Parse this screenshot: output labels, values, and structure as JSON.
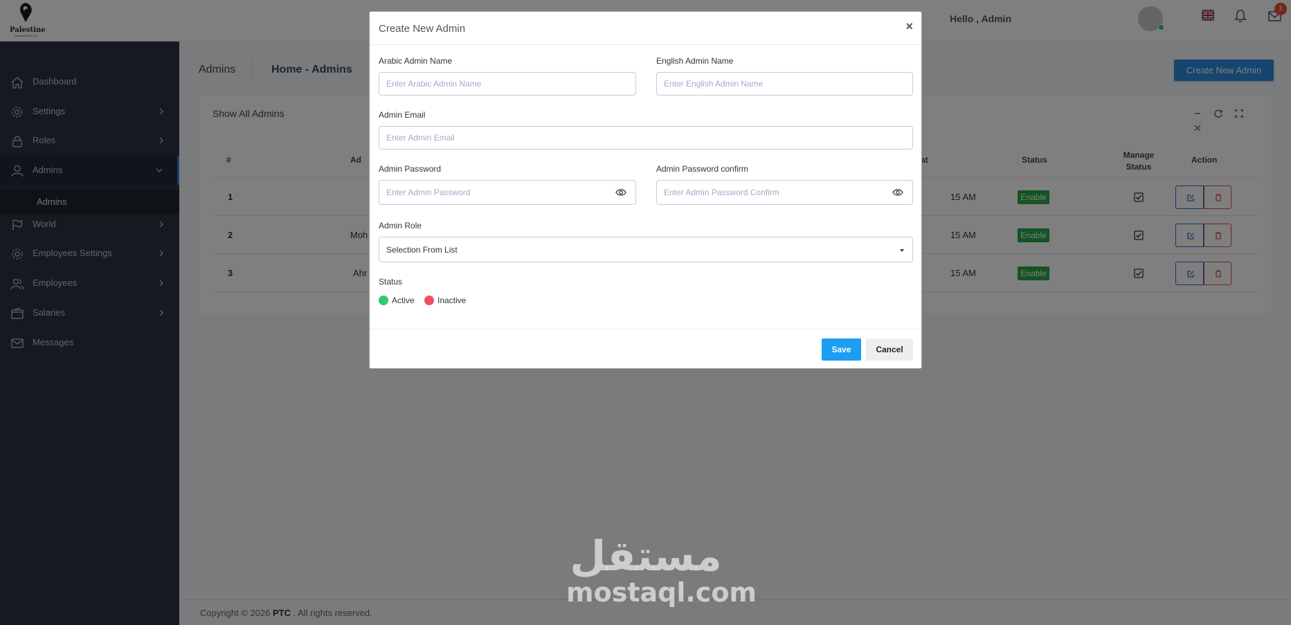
{
  "header": {
    "logo_text": "Palestine",
    "logo_subtext": "Trauma Centre UK",
    "greeting": "Hello ,  Admin",
    "notification_count": "1"
  },
  "sidebar": {
    "items": [
      {
        "label": "Dashboard",
        "icon": "home-icon"
      },
      {
        "label": "Settings",
        "icon": "gear-icon"
      },
      {
        "label": "Roles",
        "icon": "lock-icon"
      },
      {
        "label": "Admins",
        "icon": "user-icon"
      },
      {
        "label": "World",
        "icon": "flag-icon"
      },
      {
        "label": "Employees Settings",
        "icon": "gear-icon"
      },
      {
        "label": "Employees",
        "icon": "users-icon"
      },
      {
        "label": "Salaries",
        "icon": "wallet-icon"
      },
      {
        "label": "Messages",
        "icon": "mail-icon"
      }
    ],
    "sub_item": "Admins"
  },
  "breadcrumb": {
    "title": "Admins",
    "path": "Home  -  Admins"
  },
  "create_button": "Create New Admin",
  "card": {
    "title": "Show All Admins",
    "columns": [
      "#",
      "Ad",
      "at",
      "Status",
      "Manage Status",
      "Action"
    ],
    "rows": [
      {
        "num": "1",
        "name": "",
        "time": "15 AM",
        "status": "Enable"
      },
      {
        "num": "2",
        "name": "Moh",
        "time": "15 AM",
        "status": "Enable"
      },
      {
        "num": "3",
        "name": "Ahr",
        "time": "15 AM",
        "status": "Enable"
      }
    ]
  },
  "footer": {
    "prefix": "Copyright © 2026 ",
    "brand": "PTC",
    "suffix": " . All rights reserved."
  },
  "watermark": {
    "arabic": "مستقل",
    "latin": "mostaql.com"
  },
  "modal": {
    "title": "Create New Admin",
    "close": "×",
    "arabic_name_label": "Arabic Admin Name",
    "arabic_name_placeholder": "Enter Arabic Admin Name",
    "english_name_label": "English Admin Name",
    "english_name_placeholder": "Enter English Admin Name",
    "email_label": "Admin Email",
    "email_placeholder": "Enter Admin Email",
    "password_label": "Admin Password",
    "password_placeholder": "Enter Admin Password",
    "password_confirm_label": "Admin Password confirm",
    "password_confirm_placeholder": "Enter Admin Password Confirm",
    "role_label": "Admin Role",
    "role_value": "Selection From List",
    "status_label": "Status",
    "status_active": "Active",
    "status_inactive": "Inactive",
    "save": "Save",
    "cancel": "Cancel"
  },
  "colors": {
    "sidebar_bg": "#2c3340",
    "primary": "#2d8ae0",
    "save": "#1c9ef2",
    "enable_badge": "#28a745",
    "active_dot": "#2ecc71",
    "inactive_dot": "#f0505f"
  }
}
